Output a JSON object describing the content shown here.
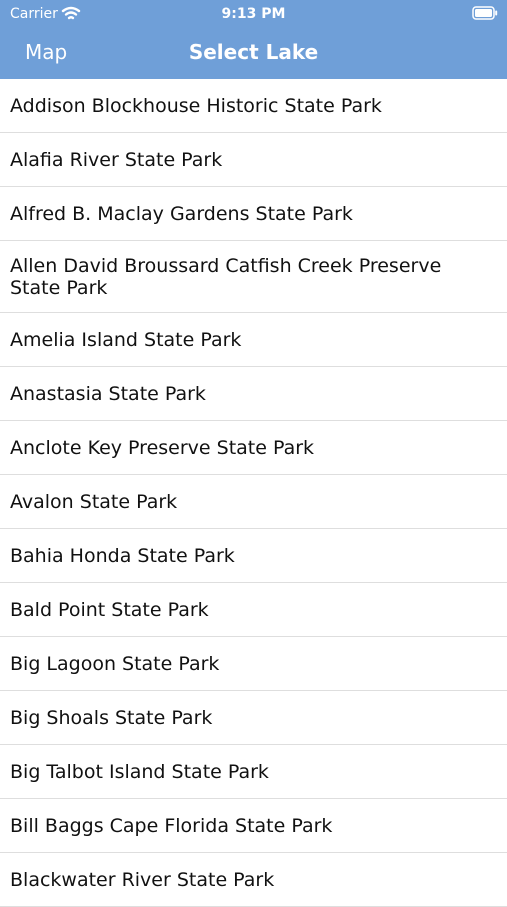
{
  "status_bar": {
    "carrier": "Carrier",
    "time": "9:13 PM",
    "wifi_icon": "wifi-icon",
    "battery_icon": "battery-icon"
  },
  "nav_bar": {
    "back_label": "Map",
    "title": "Select Lake",
    "background_color": "#6f9fd8"
  },
  "lakes": [
    {
      "label": "Addison Blockhouse Historic State Park"
    },
    {
      "label": "Alafia River State Park"
    },
    {
      "label": "Alfred B. Maclay Gardens State Park"
    },
    {
      "label": "Allen David Broussard Catfish Creek Preserve State Park"
    },
    {
      "label": "Amelia Island State Park"
    },
    {
      "label": "Anastasia State Park"
    },
    {
      "label": "Anclote Key Preserve State Park"
    },
    {
      "label": "Avalon State Park"
    },
    {
      "label": "Bahia Honda State Park"
    },
    {
      "label": "Bald Point State Park"
    },
    {
      "label": "Big Lagoon State Park"
    },
    {
      "label": "Big Shoals State Park"
    },
    {
      "label": "Big Talbot Island State Park"
    },
    {
      "label": "Bill Baggs Cape Florida State Park"
    },
    {
      "label": "Blackwater River State Park"
    }
  ]
}
